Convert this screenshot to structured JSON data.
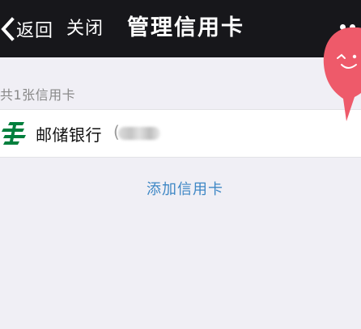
{
  "navbar": {
    "back_label": "返回",
    "close_label": "关闭",
    "title": "管理信用卡",
    "more_icon": "more-dots-icon"
  },
  "summary": {
    "count_label": "共1张信用卡"
  },
  "cards": [
    {
      "bank_name": "邮储银行",
      "logo_icon": "psbc-logo",
      "tail_open_paren": "(",
      "logo_color": "#007f3d"
    }
  ],
  "actions": {
    "add_card_label": "添加信用卡"
  },
  "colors": {
    "navbar_bg": "#17171b",
    "page_bg": "#f0eff5",
    "link": "#3e87c5",
    "float_ball": "#ee5a6a"
  }
}
